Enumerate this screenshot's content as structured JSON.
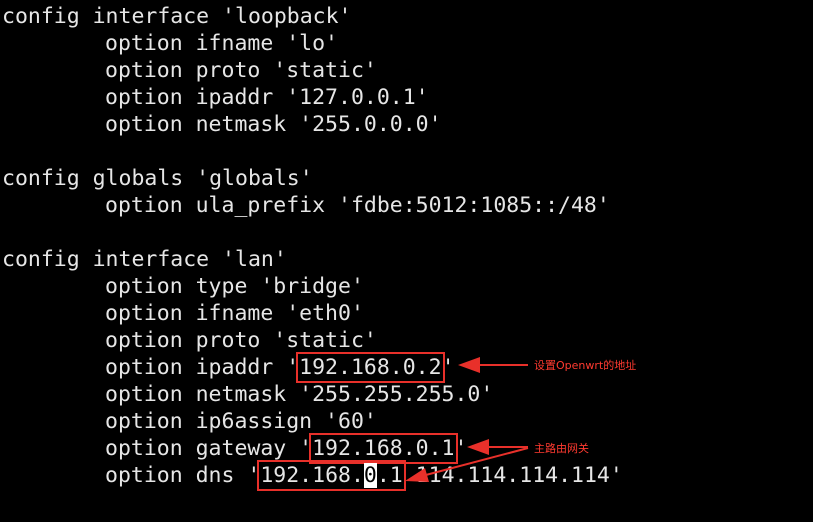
{
  "terminal": {
    "lines": [
      "config interface 'loopback'",
      "option ifname 'lo'",
      "option proto 'static'",
      "option ipaddr '127.0.0.1'",
      "option netmask '255.0.0.0'",
      "config globals 'globals'",
      "option ula_prefix 'fdbe:5012:1085::/48'",
      "config interface 'lan'",
      "option type 'bridge'",
      "option ifname 'eth0'",
      "option proto 'static'",
      "option netmask '255.255.255.0'",
      "option ip6assign '60'"
    ],
    "ipaddr_line": {
      "prefix": "option ipaddr '",
      "value": "192.168.0.2",
      "suffix": "'"
    },
    "gateway_line": {
      "prefix": "option gateway '",
      "value": "192.168.0.1",
      "suffix": "'"
    },
    "dns_line": {
      "prefix": "option dns '",
      "value_start": "192.168.",
      "cursor_char": "0",
      "value_end": ".1",
      "suffix": " 114.114.114.114'"
    }
  },
  "annotations": {
    "ip_note": "设置Openwrt的地址",
    "gateway_note": "主路由网关"
  },
  "colors": {
    "background": "#000000",
    "text": "#e6e6e6",
    "highlight": "#e8302a",
    "annotation": "#ff3a30"
  }
}
